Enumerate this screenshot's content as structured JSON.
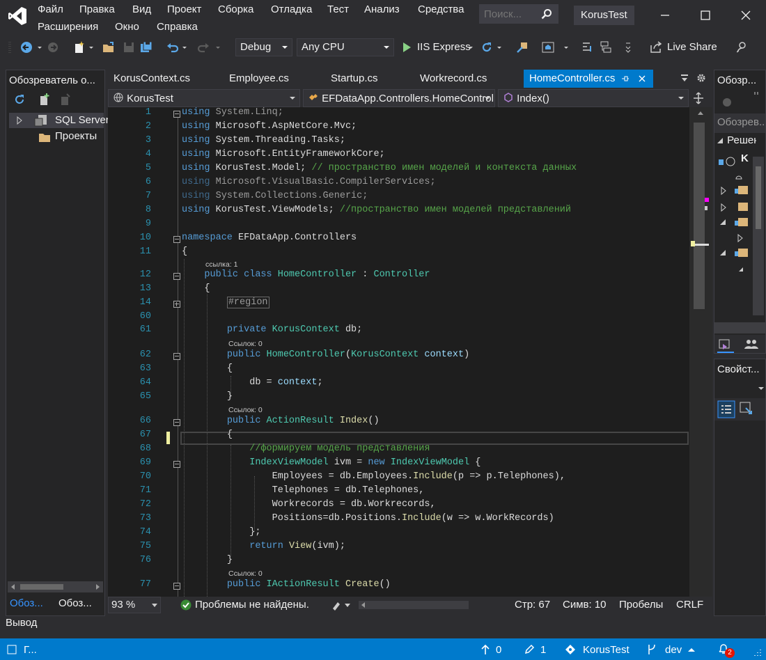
{
  "menu": {
    "file": "Файл",
    "edit": "Правка",
    "view": "Вид",
    "project": "Проект",
    "build": "Сборка",
    "debug": "Отладка",
    "test": "Тест",
    "analyze": "Анализ",
    "tools": "Средства",
    "extensions": "Расширения",
    "window": "Окно",
    "help": "Справка"
  },
  "search": {
    "placeholder": "Поиск..."
  },
  "project_title": "KorusTest",
  "toolbar": {
    "config": "Debug",
    "platform": "Any CPU",
    "run_target": "IIS Express",
    "live_share": "Live Share"
  },
  "left_panel": {
    "title": "Обозреватель о...",
    "items": [
      "SQL Server",
      "Проекты"
    ],
    "bottom_tabs": [
      "Обоз...",
      "Обоз..."
    ]
  },
  "tabs": [
    "KorusContext.cs",
    "Employee.cs",
    "Startup.cs",
    "Workrecord.cs",
    "HomeController.cs"
  ],
  "navbar": {
    "project": "KorusTest",
    "class": "EFDataApp.Controllers.HomeController",
    "member": "Index()"
  },
  "code": {
    "l1_kw": "using",
    "l1": " System.Linq;",
    "l2_kw": "using",
    "l2": " Microsoft.AspNetCore.Mvc;",
    "l3_kw": "using",
    "l3": " System.Threading.Tasks;",
    "l4_kw": "using",
    "l4": " Microsoft.EntityFrameworkCore;",
    "l5_kw": "using",
    "l5": " KorusTest.Model; ",
    "l5_cm": "// пространство имен моделей и контекста данных",
    "l6_kw": "using",
    "l6": " Microsoft.VisualBasic.CompilerServices;",
    "l7_kw": "using",
    "l7": " System.Collections.Generic;",
    "l8_kw": "using",
    "l8": " KorusTest.ViewModels; ",
    "l8_cm": "//пространство имен моделей представлений",
    "l10_kw": "namespace",
    "l10": " EFDataApp.Controllers",
    "l11": "{",
    "lens_refs1": "ссылка: 1",
    "l12_kw": "public class",
    "l12_ty": "HomeController",
    "l12_mid": " : ",
    "l12_ty2": "Controller",
    "l13": "{",
    "l14": "#region",
    "l61_kw": "private",
    "l61_ty": "KorusContext",
    "l61": " db;",
    "lens_refs0": "Ссылок: 0",
    "l62_kw": "public",
    "l62_ty": "HomeController",
    "l62_p": "(",
    "l62_ty2": "KorusContext",
    "l62_pm": " context",
    "l62_e": ")",
    "l63": "{",
    "l64_a": "db = ",
    "l64_pm": "context",
    "l64_e": ";",
    "l65": "}",
    "l66_kw": "public",
    "l66_ty": "ActionResult",
    "l66_fn": "Index",
    "l66_e": "()",
    "l67": "{",
    "l68_cm": "//формируем модель представления",
    "l69_ty": "IndexViewModel",
    "l69_a": " ivm = ",
    "l69_kw": "new",
    "l69_ty2": "IndexViewModel",
    "l69_e": " {",
    "l70_a": "Employees = db.Employees.",
    "l70_fn": "Include",
    "l70_b": "(p => p.Telephones),",
    "l71": "Telephones = db.Telephones,",
    "l72": "Workrecords = db.Workrecords,",
    "l73_a": "Positions=db.Positions.",
    "l73_fn": "Include",
    "l73_b": "(w => w.WorkRecords)",
    "l74": "};",
    "l75_kw": "return",
    "l75_fn": "View",
    "l75_e": "(ivm);",
    "l76": "}",
    "l77_kw": "public",
    "l77_ty": "IActionResult",
    "l77_fn": "Create",
    "l77_e": "()"
  },
  "line_numbers": [
    "1",
    "2",
    "3",
    "4",
    "5",
    "6",
    "7",
    "8",
    "9",
    "10",
    "11",
    "12",
    "13",
    "14",
    "60",
    "61",
    "62",
    "63",
    "64",
    "65",
    "66",
    "67",
    "68",
    "69",
    "70",
    "71",
    "72",
    "73",
    "74",
    "75",
    "76",
    "77"
  ],
  "right_panel": {
    "top_title": "Обозр...",
    "search": "Обозрев...",
    "solution": "Решен...",
    "solution_item": "K",
    "props_title": "Свойст..."
  },
  "editor_status": {
    "zoom": "93 %",
    "problems": "Проблемы не найдены.",
    "line": "Стр: 67",
    "col": "Симв: 10",
    "spaces": "Пробелы",
    "eol": "CRLF"
  },
  "output_label": "Вывод",
  "statusbar": {
    "left": "Г...",
    "up": "0",
    "edits": "1",
    "repo": "KorusTest",
    "branch": "dev",
    "notifications": "2"
  },
  "colors": {
    "accent": "#007acc",
    "keyword": "#569cd6",
    "type": "#4ec9b0",
    "comment": "#57a64a"
  }
}
